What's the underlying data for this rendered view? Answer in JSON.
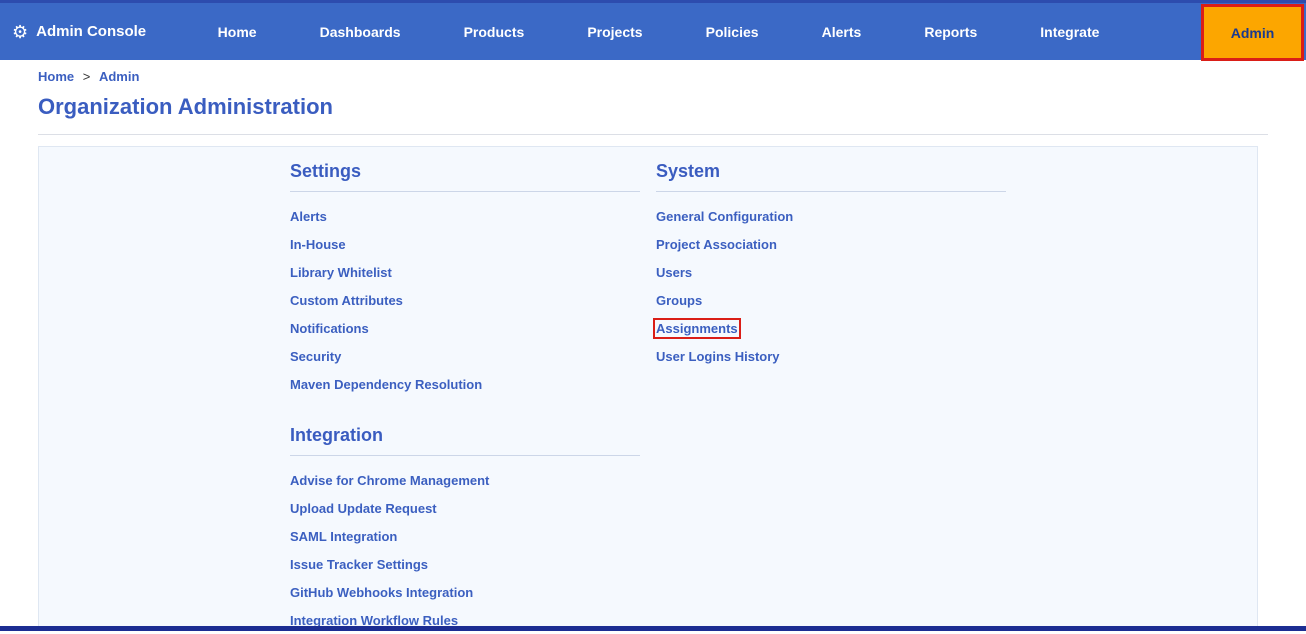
{
  "nav": {
    "brand": "Admin Console",
    "items": [
      "Home",
      "Dashboards",
      "Products",
      "Projects",
      "Policies",
      "Alerts",
      "Reports",
      "Integrate"
    ],
    "admin_button": "Admin"
  },
  "icons": {
    "gear": "⚙"
  },
  "breadcrumb": {
    "home": "Home",
    "separator": ">",
    "current": "Admin"
  },
  "page": {
    "title": "Organization Administration"
  },
  "sections": {
    "settings": {
      "title": "Settings",
      "links": [
        "Alerts",
        "In-House",
        "Library Whitelist",
        "Custom Attributes",
        "Notifications",
        "Security",
        "Maven Dependency Resolution"
      ]
    },
    "system": {
      "title": "System",
      "links": [
        "General Configuration",
        "Project Association",
        "Users",
        "Groups",
        "Assignments",
        "User Logins History"
      ]
    },
    "integration": {
      "title": "Integration",
      "links": [
        "Advise for Chrome Management",
        "Upload Update Request",
        "SAML Integration",
        "Issue Tracker Settings",
        "GitHub Webhooks Integration",
        "Integration Workflow Rules"
      ]
    }
  },
  "annotations": {
    "admin_button_outlined": true,
    "highlighted_link": "Assignments"
  },
  "colors": {
    "nav_bg": "#3b69c6",
    "accent_orange": "#fca600",
    "link_blue": "#3b5fc0",
    "annotation_red": "#da1e17",
    "bottom_strip": "#1c2d92"
  }
}
